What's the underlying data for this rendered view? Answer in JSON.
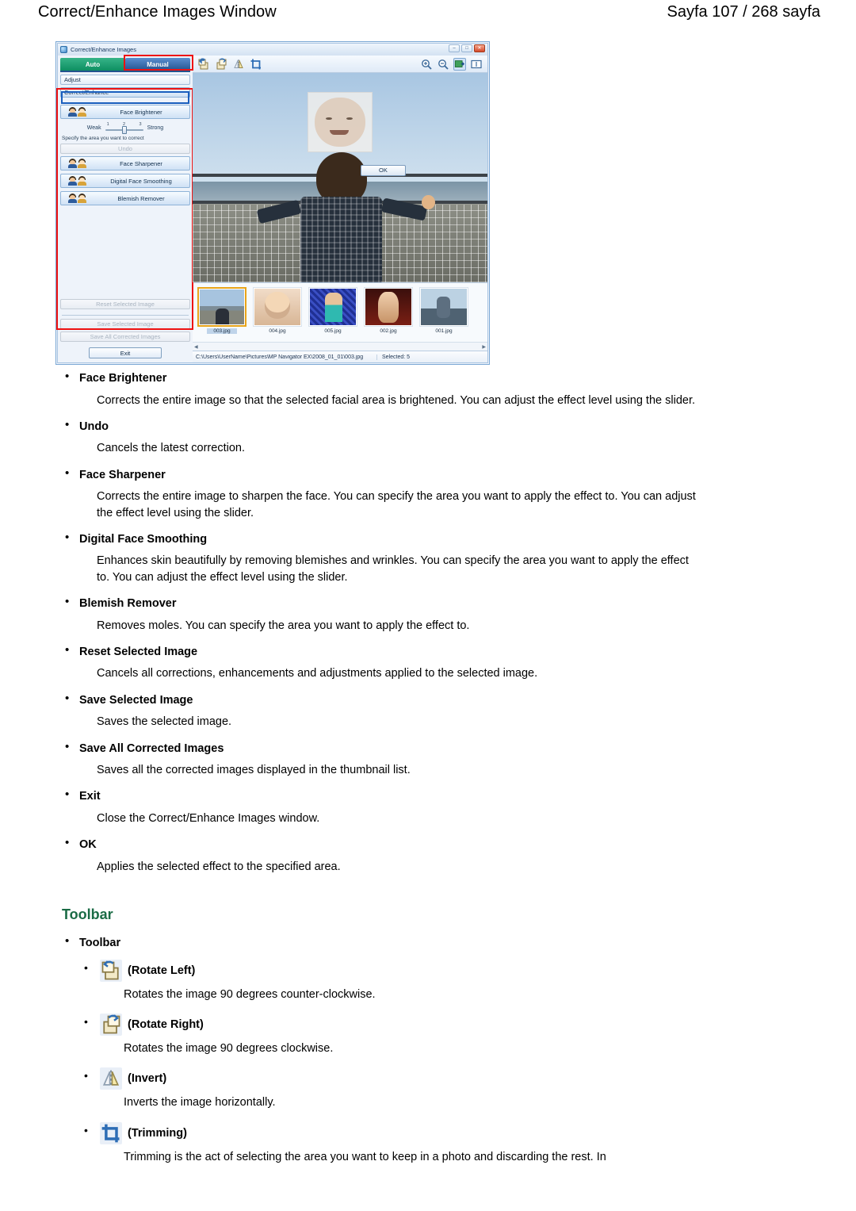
{
  "header": {
    "title": "Correct/Enhance Images Window",
    "page_indicator": "Sayfa 107 / 268 sayfa"
  },
  "app_window": {
    "title": "Correct/Enhance Images",
    "window_buttons": {
      "minimize": "–",
      "maximize": "□",
      "close": "✕"
    },
    "tabs": [
      {
        "label": "Auto",
        "selected": false,
        "color": "#0e8f62"
      },
      {
        "label": "Manual",
        "selected": true,
        "color": "#23538f"
      }
    ],
    "panel_tabs": [
      {
        "label": "Adjust",
        "selected": false
      },
      {
        "label": "Correct/Enhance",
        "selected": true
      }
    ],
    "effects": [
      {
        "label": "Face Brightener"
      },
      {
        "label": "Face Sharpener"
      },
      {
        "label": "Digital Face Smoothing"
      },
      {
        "label": "Blemish Remover"
      }
    ],
    "slider": {
      "weak_label": "Weak",
      "strong_label": "Strong",
      "ticks": [
        "1",
        "2",
        "3"
      ],
      "value": "2"
    },
    "hint": "Specify the area you want to correct",
    "undo_label": "Undo",
    "actions": [
      {
        "label": "Reset Selected Image",
        "enabled": false
      },
      {
        "label": "Save Selected Image",
        "enabled": false
      },
      {
        "label": "Save All Corrected Images",
        "enabled": false
      }
    ],
    "exit_label": "Exit",
    "toolbar_icons_left": [
      "rotate-left-icon",
      "rotate-right-icon",
      "invert-icon",
      "trimming-icon"
    ],
    "toolbar_icons_right": [
      "zoom-in-icon",
      "zoom-out-icon",
      "fit-to-screen-icon",
      "actual-size-icon"
    ],
    "canvas": {
      "ok_button": "OK"
    },
    "thumbnails": [
      {
        "caption": "003.jpg",
        "selected": true
      },
      {
        "caption": "004.jpg",
        "selected": false
      },
      {
        "caption": "005.jpg",
        "selected": false
      },
      {
        "caption": "002.jpg",
        "selected": false
      },
      {
        "caption": "001.jpg",
        "selected": false
      }
    ],
    "status": {
      "path": "C:\\Users\\UserName\\Pictures\\MP Navigator EX\\2008_01_01\\003.jpg",
      "selected": "Selected: 5"
    }
  },
  "article": {
    "items": [
      {
        "term": "Face Brightener",
        "desc": "Corrects the entire image so that the selected facial area is brightened. You can adjust the effect level using the slider."
      },
      {
        "term": "Undo",
        "desc": "Cancels the latest correction."
      },
      {
        "term": "Face Sharpener",
        "desc": "Corrects the entire image to sharpen the face. You can specify the area you want to apply the effect to. You can adjust the effect level using the slider."
      },
      {
        "term": "Digital Face Smoothing",
        "desc": "Enhances skin beautifully by removing blemishes and wrinkles. You can specify the area you want to apply the effect to. You can adjust the effect level using the slider."
      },
      {
        "term": "Blemish Remover",
        "desc": "Removes moles. You can specify the area you want to apply the effect to."
      },
      {
        "term": "Reset Selected Image",
        "desc": "Cancels all corrections, enhancements and adjustments applied to the selected image."
      },
      {
        "term": "Save Selected Image",
        "desc": "Saves the selected image."
      },
      {
        "term": "Save All Corrected Images",
        "desc": "Saves all the corrected images displayed in the thumbnail list."
      },
      {
        "term": "Exit",
        "desc": "Close the Correct/Enhance Images window."
      },
      {
        "term": "OK",
        "desc": "Applies the selected effect to the specified area."
      }
    ],
    "toolbar_section": {
      "heading": "Toolbar",
      "bullet_label": "Toolbar",
      "items": [
        {
          "icon": "rotate-left-icon",
          "label": "(Rotate Left)",
          "desc": "Rotates the image 90 degrees counter-clockwise."
        },
        {
          "icon": "rotate-right-icon",
          "label": "(Rotate Right)",
          "desc": "Rotates the image 90 degrees clockwise."
        },
        {
          "icon": "invert-icon",
          "label": "(Invert)",
          "desc": "Inverts the image horizontally."
        },
        {
          "icon": "trimming-icon",
          "label": "(Trimming)",
          "desc": "Trimming is the act of selecting the area you want to keep in a photo and discarding the rest. In"
        }
      ]
    }
  }
}
